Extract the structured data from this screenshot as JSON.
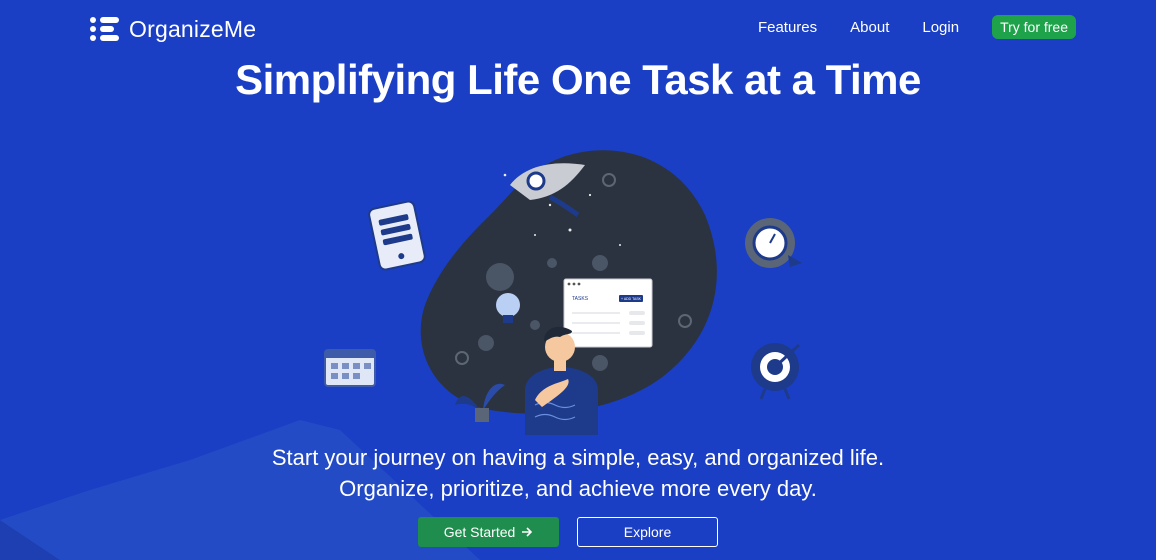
{
  "header": {
    "brand_name": "OrganizeMe",
    "nav": [
      {
        "label": "Features"
      },
      {
        "label": "About"
      },
      {
        "label": "Login"
      }
    ],
    "cta_label": "Try for free"
  },
  "hero": {
    "headline": "Simplifying Life One Task at a Time",
    "tagline_line1": "Start your journey on having a simple, easy, and organized life.",
    "tagline_line2": "Organize, prioritize, and achieve more every day.",
    "primary_button": "Get Started",
    "primary_button_icon": "arrow-right-icon",
    "secondary_button": "Explore",
    "illustration": {
      "tasks_window_title": "TASKS",
      "tasks_window_button": "+ ADD TASK"
    }
  },
  "colors": {
    "background": "#1a3fc4",
    "accent_green": "#1fa34a",
    "button_green": "#1e8d4d",
    "blob_dark": "#2b3340"
  }
}
